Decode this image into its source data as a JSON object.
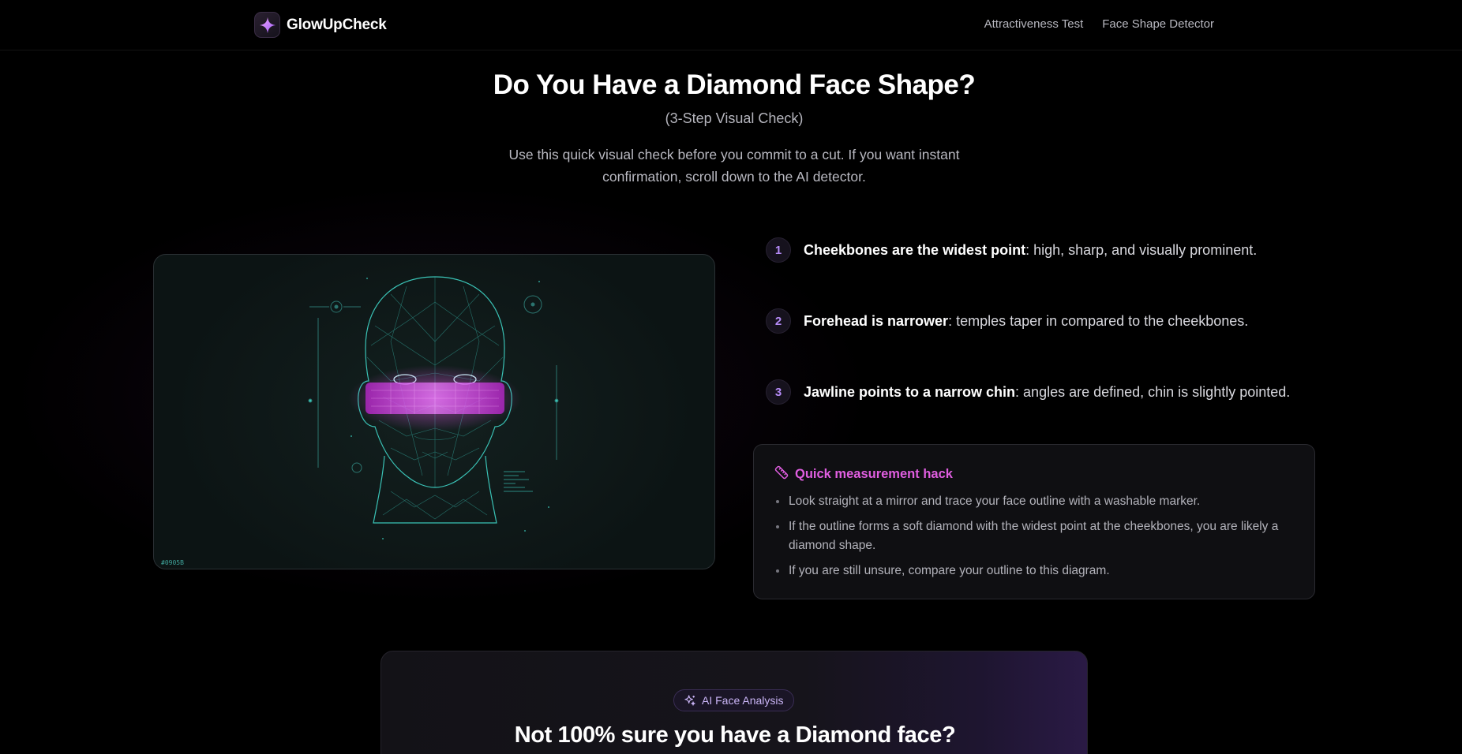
{
  "header": {
    "brand_name": "GlowUpCheck",
    "nav": [
      "Attractiveness Test",
      "Face Shape Detector"
    ]
  },
  "hero": {
    "title": "Do You Have a Diamond Face Shape?",
    "subtitle": "(3-Step Visual Check)",
    "description": "Use this quick visual check before you commit to a cut. If you want instant confirmation, scroll down to the AI detector."
  },
  "illustration": {
    "code_label": "#0905B"
  },
  "steps": [
    {
      "num": "1",
      "bold": "Cheekbones are the widest point",
      "rest": ": high, sharp, and visually prominent."
    },
    {
      "num": "2",
      "bold": "Forehead is narrower",
      "rest": ": temples taper in compared to the cheekbones."
    },
    {
      "num": "3",
      "bold": "Jawline points to a narrow chin",
      "rest": ": angles are defined, chin is slightly pointed."
    }
  ],
  "hack": {
    "title": "Quick measurement hack",
    "items": [
      "Look straight at a mirror and trace your face outline with a washable marker.",
      "If the outline forms a soft diamond with the widest point at the cheekbones, you are likely a diamond shape.",
      "If you are still unsure, compare your outline to this diagram."
    ]
  },
  "ai": {
    "badge": "AI Face Analysis",
    "title": "Not 100% sure you have a Diamond face?"
  },
  "colors": {
    "accent_purple": "#b58bf6",
    "hack_pink": "#e05ee0",
    "mesh_cyan": "#3fd6c8",
    "highlight_magenta": "#e23ef0"
  },
  "icons": {
    "brand": "sparkle-icon",
    "hack": "ruler-icon",
    "ai": "sparkles-icon"
  }
}
